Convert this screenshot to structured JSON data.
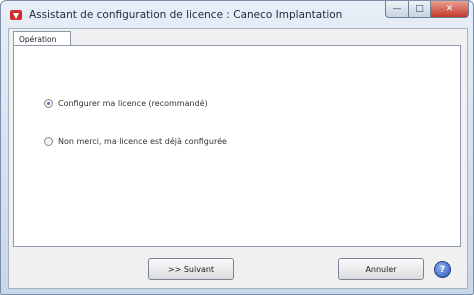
{
  "window": {
    "title": "Assistant de configuration de licence : Caneco Implantation"
  },
  "tabs": [
    {
      "label": "Opération"
    }
  ],
  "options": [
    {
      "label": "Configurer ma licence (recommandé)",
      "checked": true
    },
    {
      "label": "Non merci, ma licence est déjà configurée",
      "checked": false
    }
  ],
  "buttons": {
    "next": ">> Suivant",
    "cancel": "Annuler"
  },
  "icons": {
    "app": "caneco-app-icon",
    "help": "help-icon"
  }
}
